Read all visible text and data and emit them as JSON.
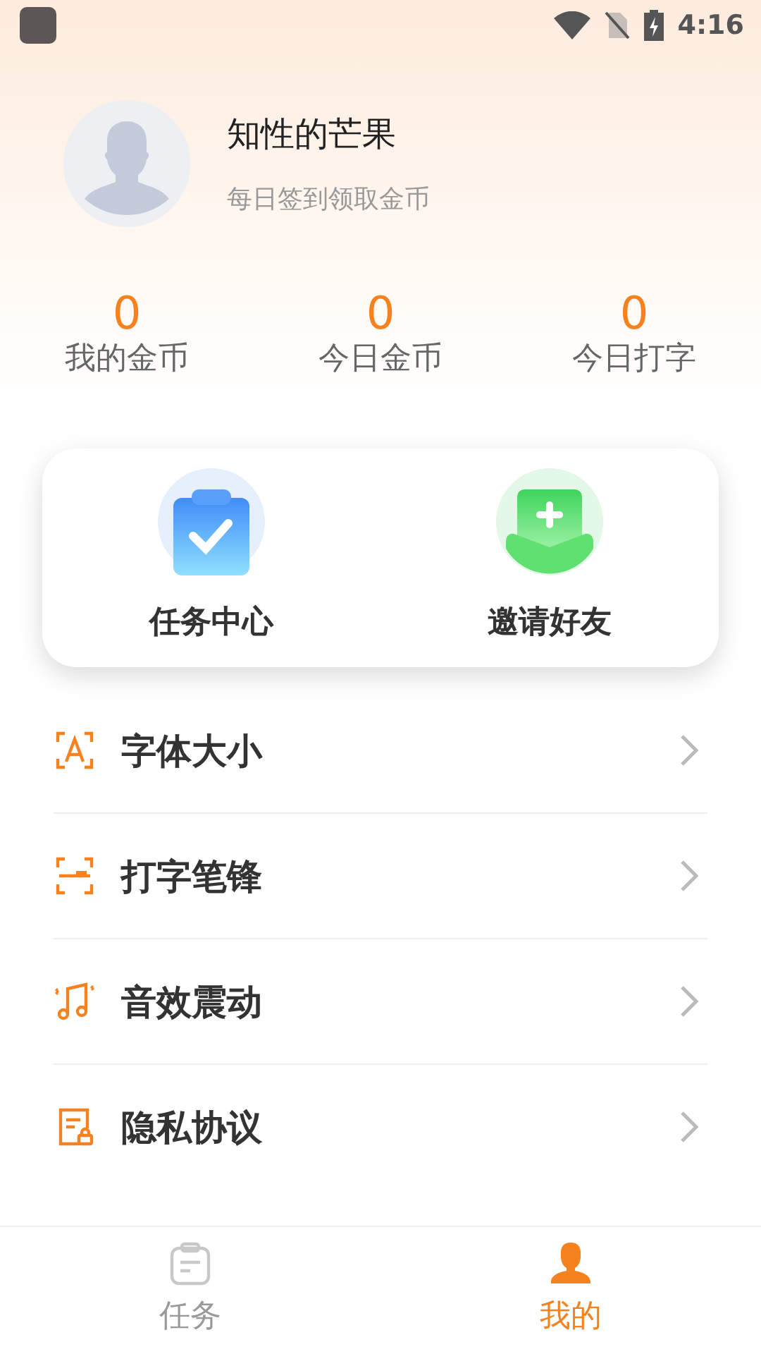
{
  "status_bar": {
    "time": "4:16"
  },
  "profile": {
    "name": "知性的芒果",
    "subtitle": "每日签到领取金币"
  },
  "stats": [
    {
      "value": "0",
      "label": "我的金币"
    },
    {
      "value": "0",
      "label": "今日金币"
    },
    {
      "value": "0",
      "label": "今日打字"
    }
  ],
  "shortcuts": [
    {
      "kind": "tasks",
      "label": "任务中心"
    },
    {
      "kind": "invite",
      "label": "邀请好友"
    }
  ],
  "menu": [
    {
      "kind": "font",
      "label": "字体大小"
    },
    {
      "kind": "stroke",
      "label": "打字笔锋"
    },
    {
      "kind": "sound",
      "label": "音效震动"
    },
    {
      "kind": "privacy",
      "label": "隐私协议"
    }
  ],
  "tabs": [
    {
      "kind": "tasks",
      "label": "任务",
      "selected": false
    },
    {
      "kind": "me",
      "label": "我的",
      "selected": true
    }
  ]
}
